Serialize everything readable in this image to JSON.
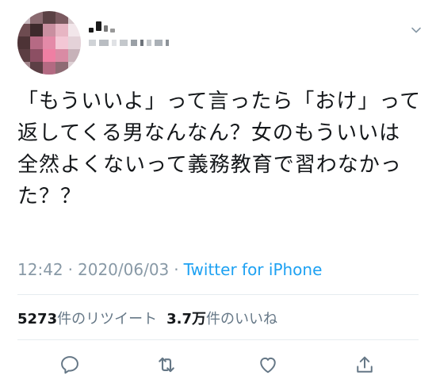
{
  "user": {
    "display_name": "",
    "handle": "",
    "avatar": "avatar-icon"
  },
  "tweet": {
    "text": "「もういいよ」って言ったら「おけ」って返してくる男なんなん？女のもういいは全然よくないって義務教育で習わなかった？？",
    "time": "12:42",
    "separator": "·",
    "date": "2020/06/03",
    "source": "Twitter for iPhone"
  },
  "stats": {
    "retweets_count": "5273",
    "retweets_label": "件のリツイート",
    "likes_count": "3.7万",
    "likes_label": "件のいいね"
  },
  "actions": {
    "reply": "reply-icon",
    "retweet": "retweet-icon",
    "like": "heart-icon",
    "share": "share-icon"
  },
  "colors": {
    "text": "#14171a",
    "muted": "#8899a6",
    "link": "#1da1f2",
    "divider": "#e6ecf0",
    "icon": "#657786"
  }
}
